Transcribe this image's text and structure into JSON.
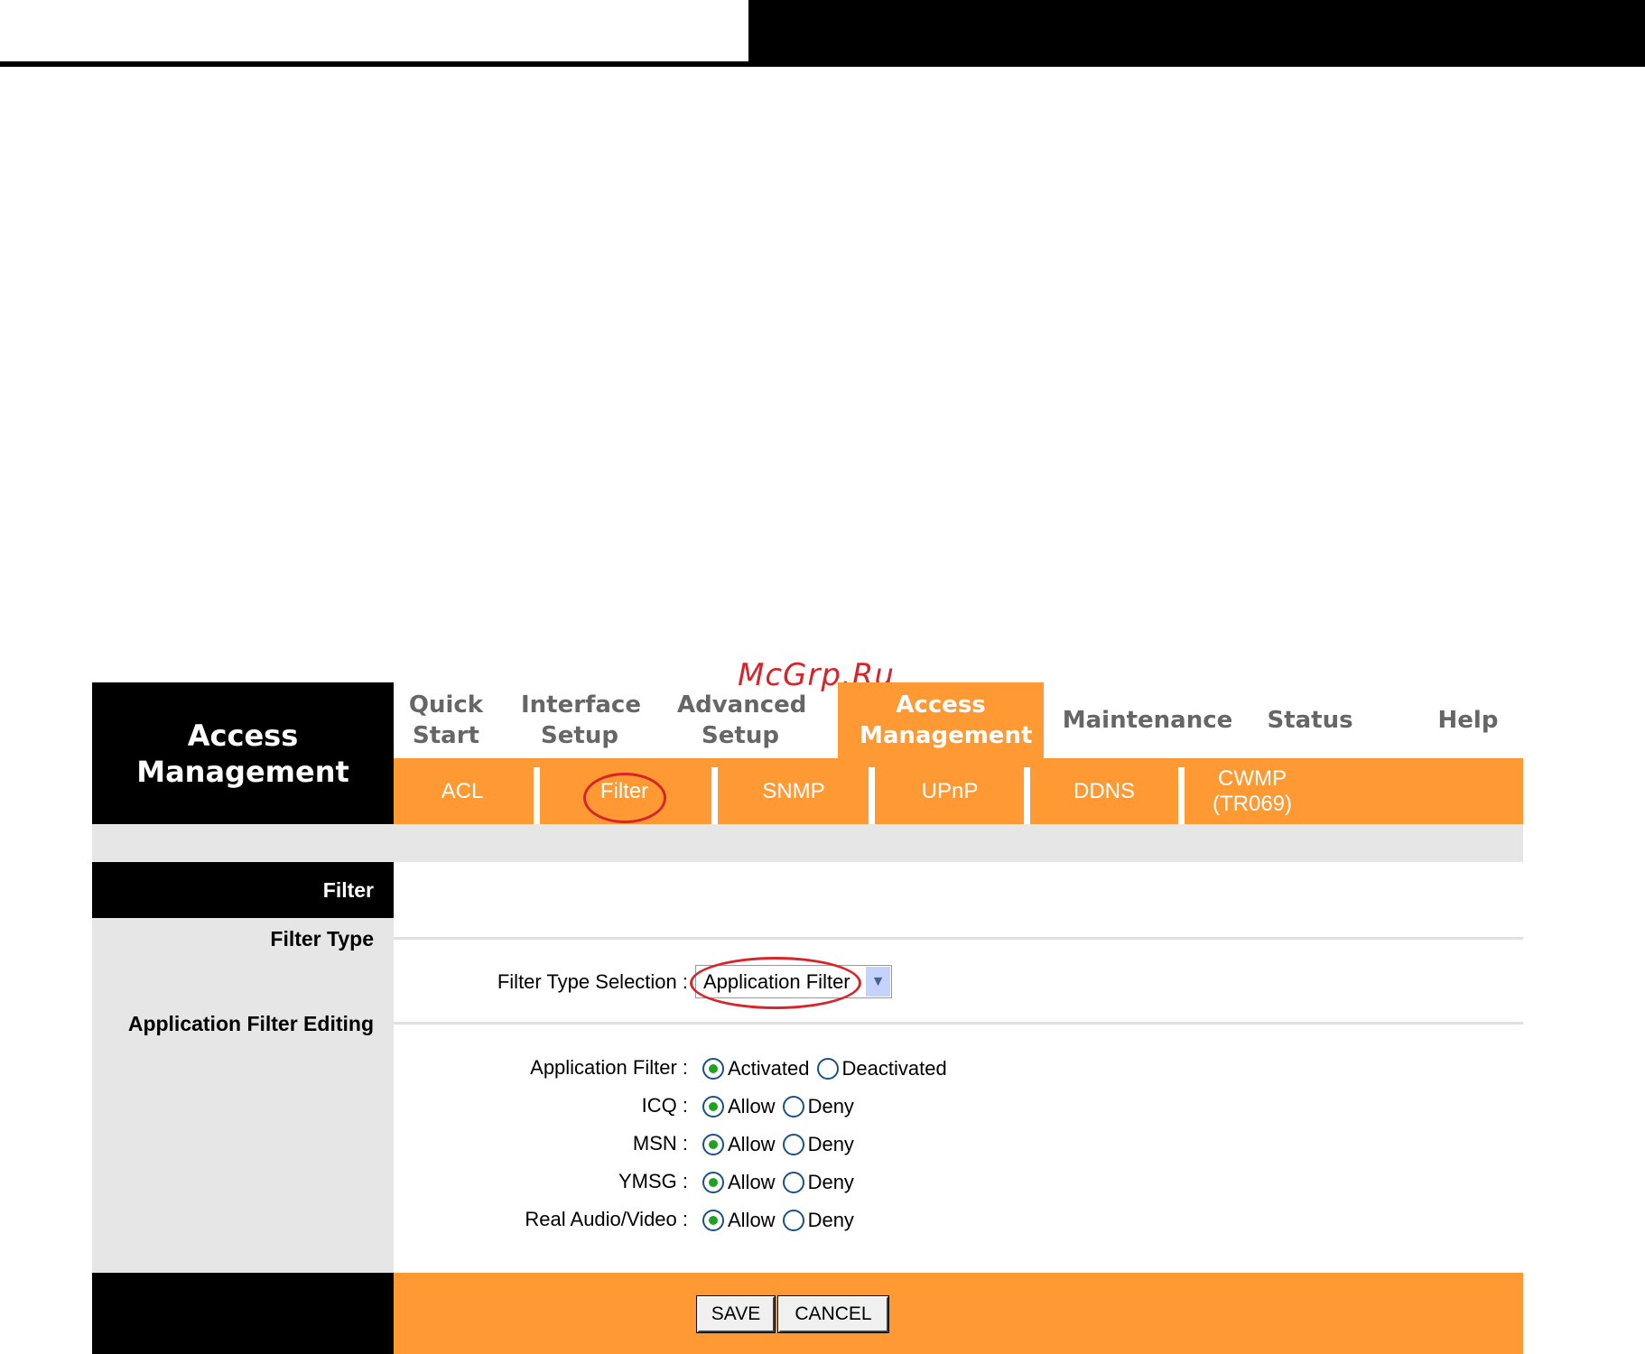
{
  "watermark": "McGrp.Ru",
  "brand": {
    "title": "Access Management"
  },
  "main_nav": [
    {
      "label": "Quick Start",
      "active": false
    },
    {
      "label": "Interface Setup",
      "active": false
    },
    {
      "label": "Advanced Setup",
      "active": false
    },
    {
      "label": "Access Management",
      "active": true
    },
    {
      "label": "Maintenance",
      "active": false
    },
    {
      "label": "Status",
      "active": false
    },
    {
      "label": "Help",
      "active": false
    }
  ],
  "sub_nav": [
    {
      "label": "ACL",
      "active": false
    },
    {
      "label": "Filter",
      "active": true
    },
    {
      "label": "SNMP",
      "active": false
    },
    {
      "label": "UPnP",
      "active": false
    },
    {
      "label": "DDNS",
      "active": false
    },
    {
      "label": "CWMP (TR069)",
      "active": false
    }
  ],
  "sections": {
    "filter": "Filter",
    "filter_type": "Filter Type",
    "app_filter_editing": "Application Filter Editing"
  },
  "filter_type_selection": {
    "label": "Filter Type Selection :",
    "value": "Application Filter"
  },
  "application_filter": {
    "label": "Application Filter :",
    "options": [
      "Activated",
      "Deactivated"
    ],
    "selected": "Activated"
  },
  "apps": [
    {
      "label": "ICQ :",
      "allow": "Allow",
      "deny": "Deny",
      "selected": "Allow"
    },
    {
      "label": "MSN :",
      "allow": "Allow",
      "deny": "Deny",
      "selected": "Allow"
    },
    {
      "label": "YMSG :",
      "allow": "Allow",
      "deny": "Deny",
      "selected": "Allow"
    },
    {
      "label": "Real Audio/Video :",
      "allow": "Allow",
      "deny": "Deny",
      "selected": "Allow"
    }
  ],
  "buttons": {
    "save": "SAVE",
    "cancel": "CANCEL"
  },
  "colors": {
    "orange": "#ff9933",
    "black": "#000000",
    "grey": "#e6e6e6",
    "annotation_red": "#d4262c"
  }
}
